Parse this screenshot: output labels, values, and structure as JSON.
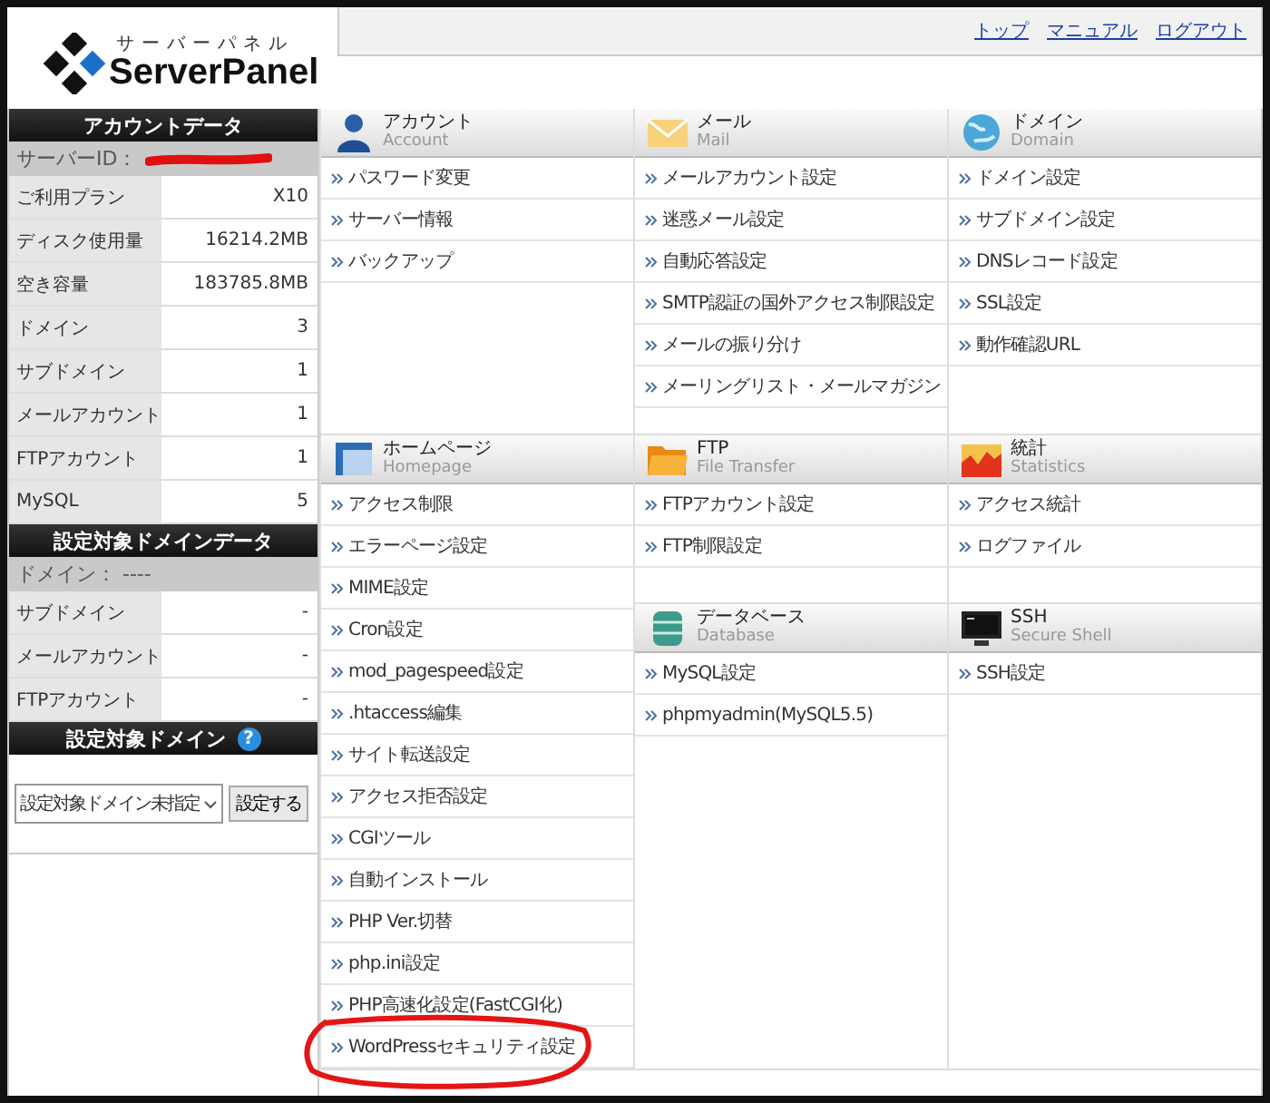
{
  "logo": {
    "kana": "サーバーパネル",
    "title": "ServerPanel"
  },
  "header_links": [
    "トップ",
    "マニュアル",
    "ログアウト"
  ],
  "sidebar": {
    "account_data": {
      "title": "アカウントデータ",
      "server_id_label": "サーバーID：",
      "rows": [
        {
          "label": "ご利用プラン",
          "value": "X10"
        },
        {
          "label": "ディスク使用量",
          "value": "16214.2MB"
        },
        {
          "label": "空き容量",
          "value": "183785.8MB"
        },
        {
          "label": "ドメイン",
          "value": "3"
        },
        {
          "label": "サブドメイン",
          "value": "1"
        },
        {
          "label": "メールアカウント",
          "value": "1"
        },
        {
          "label": "FTPアカウント",
          "value": "1"
        },
        {
          "label": "MySQL",
          "value": "5"
        }
      ]
    },
    "domain_data": {
      "title": "設定対象ドメインデータ",
      "domain_label": "ドメイン： ----",
      "rows": [
        {
          "label": "サブドメイン",
          "value": "-"
        },
        {
          "label": "メールアカウント",
          "value": "-"
        },
        {
          "label": "FTPアカウント",
          "value": "-"
        }
      ]
    },
    "domain_select": {
      "title": "設定対象ドメイン",
      "help": "?",
      "value": "設定対象ドメイン未指定",
      "button": "設定する"
    }
  },
  "sections": [
    {
      "kind": "account",
      "title": "アカウント",
      "subtitle": "Account",
      "items": [
        "パスワード変更",
        "サーバー情報",
        "バックアップ"
      ]
    },
    {
      "kind": "mail",
      "title": "メール",
      "subtitle": "Mail",
      "items": [
        "メールアカウント設定",
        "迷惑メール設定",
        "自動応答設定",
        "SMTP認証の国外アクセス制限設定",
        "メールの振り分け",
        "メーリングリスト・メールマガジン"
      ]
    },
    {
      "kind": "domain",
      "title": "ドメイン",
      "subtitle": "Domain",
      "items": [
        "ドメイン設定",
        "サブドメイン設定",
        "DNSレコード設定",
        "SSL設定",
        "動作確認URL"
      ]
    },
    {
      "kind": "homepage",
      "title": "ホームページ",
      "subtitle": "Homepage",
      "items": [
        "アクセス制限",
        "エラーページ設定",
        "MIME設定",
        "Cron設定",
        "mod_pagespeed設定",
        ".htaccess編集",
        "サイト転送設定",
        "アクセス拒否設定",
        "CGIツール",
        "自動インストール",
        "PHP Ver.切替",
        "php.ini設定",
        "PHP高速化設定(FastCGI化)",
        "WordPressセキュリティ設定"
      ]
    },
    {
      "kind": "ftp",
      "title": "FTP",
      "subtitle": "File Transfer",
      "items": [
        "FTPアカウント設定",
        "FTP制限設定"
      ]
    },
    {
      "kind": "stats",
      "title": "統計",
      "subtitle": "Statistics",
      "items": [
        "アクセス統計",
        "ログファイル"
      ]
    },
    {
      "kind": "database",
      "title": "データベース",
      "subtitle": "Database",
      "items": [
        "MySQL設定",
        "phpmyadmin(MySQL5.5)"
      ]
    },
    {
      "kind": "ssh",
      "title": "SSH",
      "subtitle": "Secure Shell",
      "items": [
        "SSH設定"
      ]
    }
  ]
}
